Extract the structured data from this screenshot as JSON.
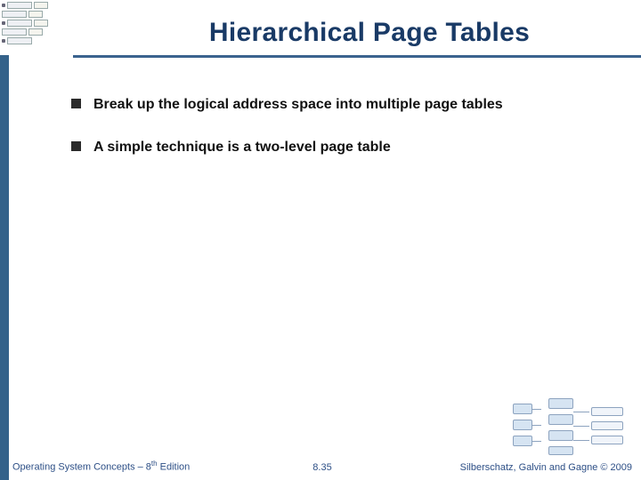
{
  "title": "Hierarchical Page Tables",
  "bullets": [
    "Break up the logical address space into multiple page tables",
    "A simple technique is a two-level page table"
  ],
  "footer": {
    "left_prefix": "Operating System Concepts – 8",
    "left_suffix_super": "th",
    "left_tail": " Edition",
    "center": "8.35",
    "right": "Silberschatz, Galvin and Gagne © 2009"
  }
}
